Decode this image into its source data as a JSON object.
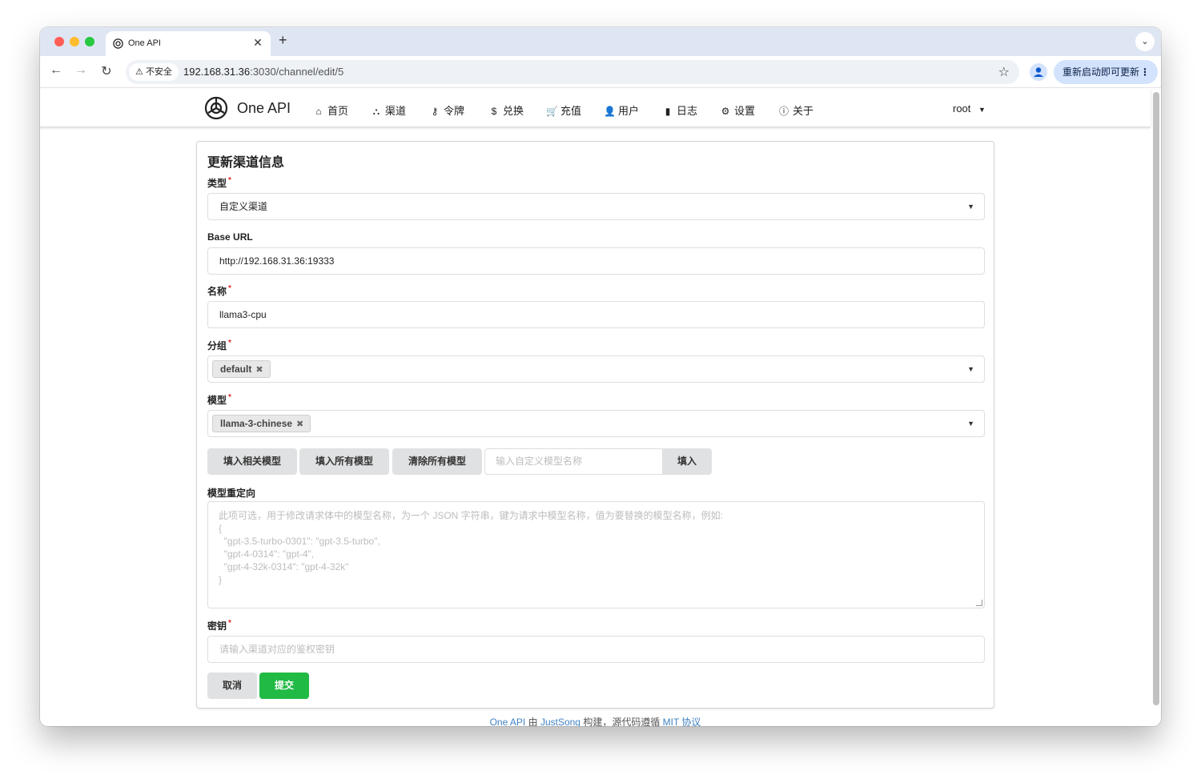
{
  "browser": {
    "tab_title": "One API",
    "tab_close": "✕",
    "new_tab": "+",
    "insecure_label": "不安全",
    "url_host": "192.168.31.36",
    "url_rest": ":3030/channel/edit/5",
    "update_button": "重新启动即可更新",
    "update_menu": "⋮"
  },
  "header": {
    "brand": "One API",
    "menu": [
      {
        "label": "首页",
        "icon": "home-icon",
        "glyph": "⌂"
      },
      {
        "label": "渠道",
        "icon": "sitemap-icon",
        "glyph": "⛬"
      },
      {
        "label": "令牌",
        "icon": "key-icon",
        "glyph": "⚷"
      },
      {
        "label": "兑换",
        "icon": "dollar-icon",
        "glyph": "$"
      },
      {
        "label": "充值",
        "icon": "cart-icon",
        "glyph": "🛒"
      },
      {
        "label": "用户",
        "icon": "user-icon",
        "glyph": "👤"
      },
      {
        "label": "日志",
        "icon": "book-icon",
        "glyph": "▮"
      },
      {
        "label": "设置",
        "icon": "gear-icon",
        "glyph": "⚙"
      },
      {
        "label": "关于",
        "icon": "info-icon",
        "glyph": "ⓘ"
      }
    ],
    "user": "root"
  },
  "form": {
    "title": "更新渠道信息",
    "type_label": "类型",
    "type_value": "自定义渠道",
    "base_url_label": "Base URL",
    "base_url_value": "http://192.168.31.36:19333",
    "name_label": "名称",
    "name_value": "llama3-cpu",
    "group_label": "分组",
    "group_chips": [
      "default"
    ],
    "models_label": "模型",
    "model_chips": [
      "llama-3-chinese"
    ],
    "btn_fill_related": "填入相关模型",
    "btn_fill_all": "填入所有模型",
    "btn_clear_all": "清除所有模型",
    "custom_model_placeholder": "输入自定义模型名称",
    "btn_fill": "填入",
    "mapping_label": "模型重定向",
    "mapping_placeholder": "此项可选，用于修改请求体中的模型名称，为一个 JSON 字符串，键为请求中模型名称，值为要替换的模型名称，例如:\n{\n  \"gpt-3.5-turbo-0301\": \"gpt-3.5-turbo\",\n  \"gpt-4-0314\": \"gpt-4\",\n  \"gpt-4-32k-0314\": \"gpt-4-32k\"\n}",
    "key_label": "密钥",
    "key_placeholder": "请输入渠道对应的鉴权密钥",
    "btn_cancel": "取消",
    "btn_submit": "提交"
  },
  "footer": {
    "text_a": "One API",
    "text_b": " 由 ",
    "text_c": "JustSong",
    "text_d": " 构建，源代码遵循 ",
    "text_e": "MIT 协议"
  },
  "colors": {
    "accent_green": "#21ba45",
    "required_red": "#db2828",
    "link_blue": "#4183c4"
  }
}
